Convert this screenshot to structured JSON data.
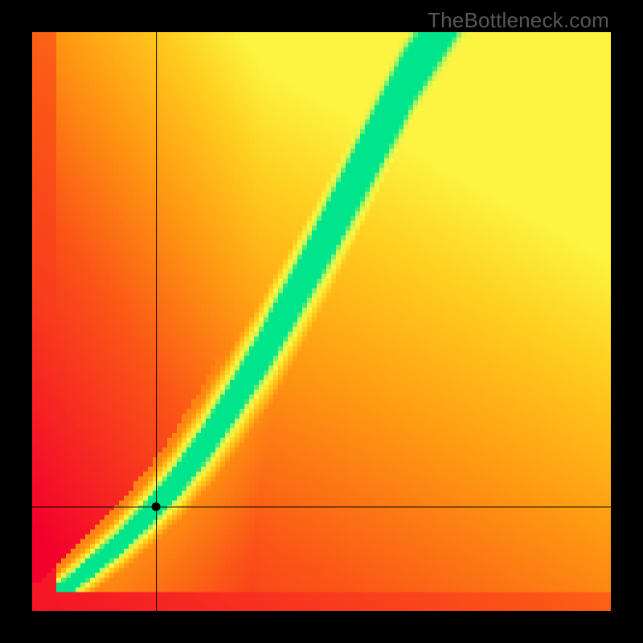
{
  "watermark": "TheBottleneck.com",
  "chart_data": {
    "type": "heatmap",
    "title": "",
    "xlabel": "",
    "ylabel": "",
    "xlim": [
      0,
      1
    ],
    "ylim": [
      0,
      1
    ],
    "grid_resolution": 120,
    "marker": {
      "x": 0.214,
      "y": 0.18
    },
    "crosshair": {
      "x": 0.214,
      "y": 0.18
    },
    "optimal_curve": {
      "comment": "y = f(x) along which score is maximal (green ridge)",
      "samples": [
        {
          "x": 0.0,
          "y": 0.0
        },
        {
          "x": 0.05,
          "y": 0.035
        },
        {
          "x": 0.1,
          "y": 0.075
        },
        {
          "x": 0.15,
          "y": 0.118
        },
        {
          "x": 0.2,
          "y": 0.168
        },
        {
          "x": 0.25,
          "y": 0.225
        },
        {
          "x": 0.3,
          "y": 0.292
        },
        {
          "x": 0.35,
          "y": 0.368
        },
        {
          "x": 0.4,
          "y": 0.45
        },
        {
          "x": 0.45,
          "y": 0.54
        },
        {
          "x": 0.5,
          "y": 0.632
        },
        {
          "x": 0.55,
          "y": 0.728
        },
        {
          "x": 0.6,
          "y": 0.825
        },
        {
          "x": 0.65,
          "y": 0.92
        },
        {
          "x": 0.7,
          "y": 1.0
        }
      ]
    },
    "colormap": {
      "stops": [
        {
          "t": 0.0,
          "color": "#f3002c"
        },
        {
          "t": 0.35,
          "color": "#fb5617"
        },
        {
          "t": 0.55,
          "color": "#ff9a12"
        },
        {
          "t": 0.72,
          "color": "#ffd020"
        },
        {
          "t": 0.84,
          "color": "#fdf744"
        },
        {
          "t": 0.92,
          "color": "#c2f55a"
        },
        {
          "t": 1.0,
          "color": "#00e58b"
        }
      ]
    }
  }
}
